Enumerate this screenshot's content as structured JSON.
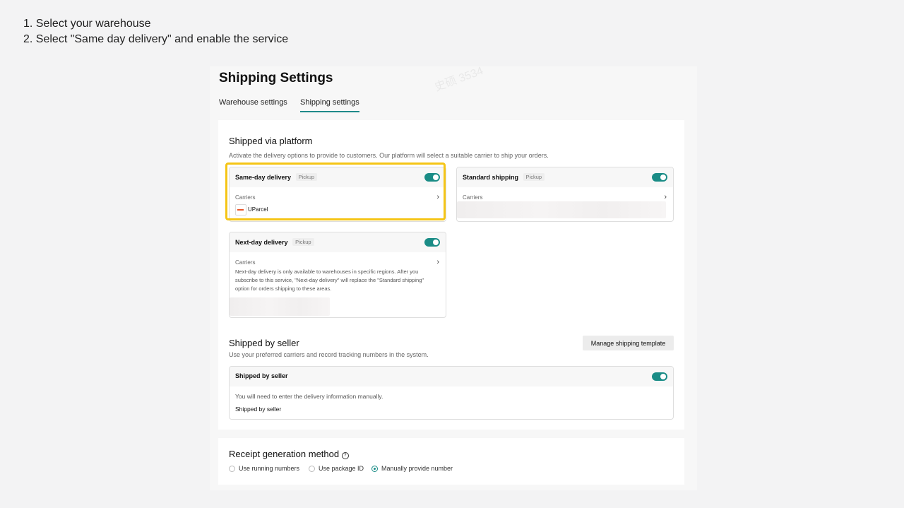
{
  "instructions": [
    "1. Select your warehouse",
    "2. Select \"Same day delivery\" and enable the service"
  ],
  "page_title": "Shipping Settings",
  "tabs": [
    {
      "label": "Warehouse settings",
      "active": false
    },
    {
      "label": "Shipping settings",
      "active": true
    }
  ],
  "platform": {
    "title": "Shipped via platform",
    "subtitle": "Activate the delivery options to provide to customers. Our platform will select a suitable carrier to ship your orders.",
    "cards": {
      "same_day": {
        "title": "Same-day delivery",
        "badge": "Pickup",
        "enabled": true,
        "carriers_label": "Carriers",
        "carrier_name": "UParcel"
      },
      "standard": {
        "title": "Standard shipping",
        "badge": "Pickup",
        "enabled": true,
        "carriers_label": "Carriers"
      },
      "next_day": {
        "title": "Next-day delivery",
        "badge": "Pickup",
        "enabled": true,
        "carriers_label": "Carriers",
        "description_lines": [
          "Next-day delivery is only available to warehouses in specific regions. After you",
          "subscribe to this service, \"Next-day delivery\" will replace the \"Standard shipping\"",
          "option for orders shipping to these areas."
        ]
      }
    }
  },
  "seller": {
    "title": "Shipped by seller",
    "subtitle": "Use your preferred carriers and record tracking numbers in the system.",
    "manage_button": "Manage shipping template",
    "card": {
      "title": "Shipped by seller",
      "enabled": true,
      "note": "You will need to enter the delivery information manually.",
      "footer": "Shipped by seller"
    }
  },
  "receipt": {
    "title": "Receipt generation method",
    "options": [
      {
        "label": "Use running numbers",
        "selected": false
      },
      {
        "label": "Use package ID",
        "selected": false
      },
      {
        "label": "Manually provide number",
        "selected": true
      }
    ]
  },
  "watermark": "史硕 3534",
  "colors": {
    "accent": "#1a8c86",
    "highlight": "#f5c516"
  }
}
